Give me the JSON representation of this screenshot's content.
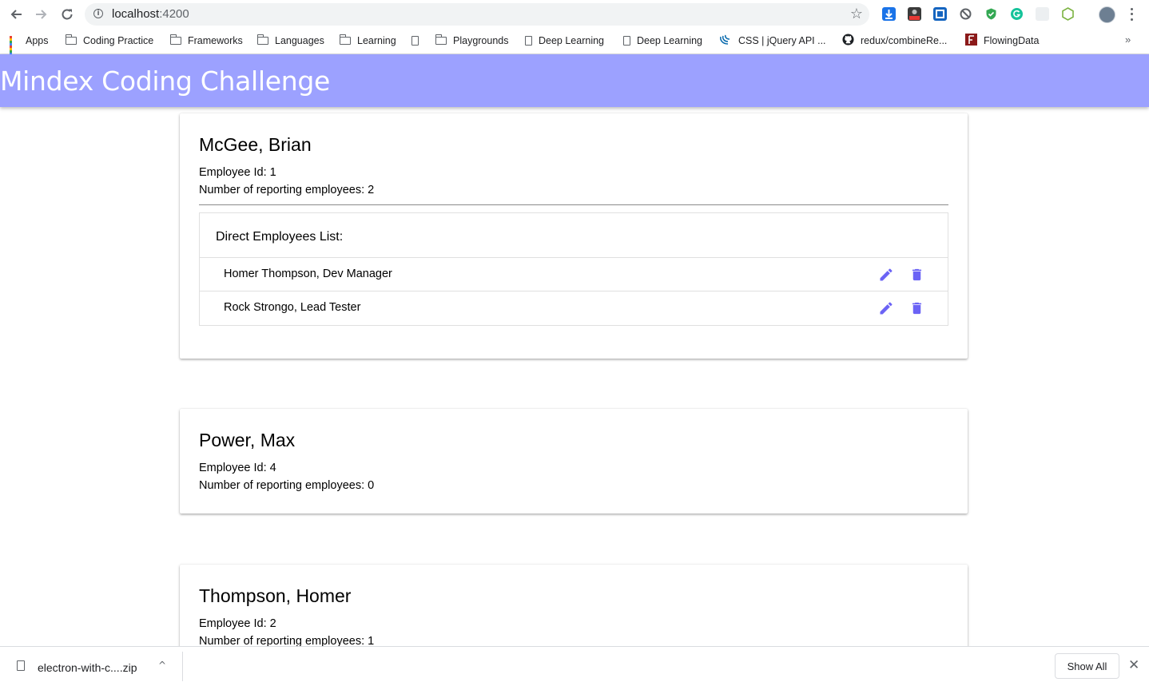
{
  "browser": {
    "url_host": "localhost",
    "url_port": ":4200",
    "bookmarks": [
      {
        "label": "Apps",
        "icon": "apps-icon"
      },
      {
        "label": "Coding Practice",
        "icon": "folder-icon"
      },
      {
        "label": "Frameworks",
        "icon": "folder-icon"
      },
      {
        "label": "Languages",
        "icon": "folder-icon"
      },
      {
        "label": "Learning",
        "icon": "folder-icon"
      },
      {
        "label": "",
        "icon": "page-icon"
      },
      {
        "label": "Playgrounds",
        "icon": "folder-icon"
      },
      {
        "label": "Deep Learning",
        "icon": "page-icon"
      },
      {
        "label": "Deep Learning",
        "icon": "page-icon"
      },
      {
        "label": "CSS | jQuery API ...",
        "icon": "jquery-icon"
      },
      {
        "label": "redux/combineRe...",
        "icon": "github-icon"
      },
      {
        "label": "FlowingData",
        "icon": "flowingdata-icon"
      }
    ],
    "more_label": "»"
  },
  "app": {
    "title": "Mindex Coding Challenge",
    "accent_color": "#9ca1ff",
    "icon_color": "#6b63f5"
  },
  "employees": [
    {
      "name": "McGee, Brian",
      "id_line": "Employee Id: 1",
      "reports_line": "Number of reporting employees: 2",
      "direct_reports_title": "Direct Employees List:",
      "direct_reports": [
        {
          "label": "Homer Thompson, Dev Manager"
        },
        {
          "label": "Rock Strongo, Lead Tester"
        }
      ]
    },
    {
      "name": "Power, Max",
      "id_line": "Employee Id: 4",
      "reports_line": "Number of reporting employees: 0"
    },
    {
      "name": "Thompson, Homer",
      "id_line": "Employee Id: 2",
      "reports_line": "Number of reporting employees: 1"
    }
  ],
  "download_shelf": {
    "file_name": "electron-with-c....zip",
    "show_all_label": "Show All"
  }
}
